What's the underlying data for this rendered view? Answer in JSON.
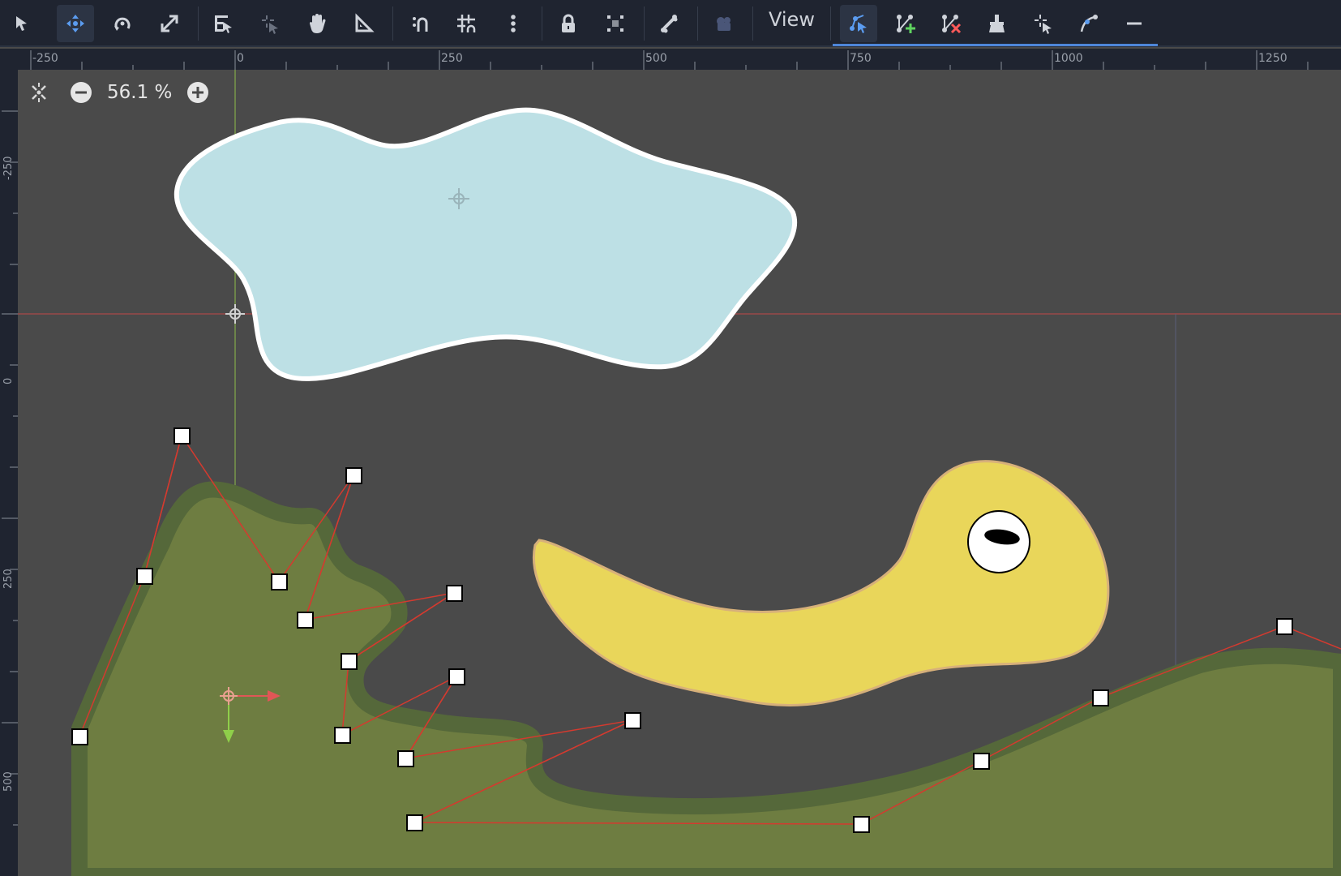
{
  "toolbar": {
    "view_label": "View"
  },
  "ruler": {
    "horizontal_labels": [
      "-250",
      "0",
      "250",
      "500",
      "750",
      "1000",
      "1250"
    ],
    "vertical_labels": [
      "-250",
      "0",
      "250",
      "500"
    ]
  },
  "zoom": {
    "value_text": "56.1 %"
  },
  "colors": {
    "background": "#4a4a4a",
    "toolbar": "#1f2430",
    "water": "#bde0e5",
    "ground": "#6e7d41",
    "ground_outline": "#55683a",
    "creature": "#e9d65a",
    "polygon_edge": "#d43a2f",
    "accent": "#4e86d8"
  },
  "icons": [
    "select-icon",
    "move-icon",
    "rotate-icon",
    "scale-icon",
    "list-select-icon",
    "pivot-icon",
    "pan-icon",
    "ruler-icon",
    "smart-snap-icon",
    "grid-snap-icon",
    "more-icon",
    "lock-icon",
    "group-icon",
    "skeleton-icon",
    "camera-icon",
    "select-points-icon",
    "create-points-icon",
    "delete-points-icon",
    "edit-ik-icon",
    "select-point-icon",
    "curve-icon",
    "minus-icon"
  ]
}
